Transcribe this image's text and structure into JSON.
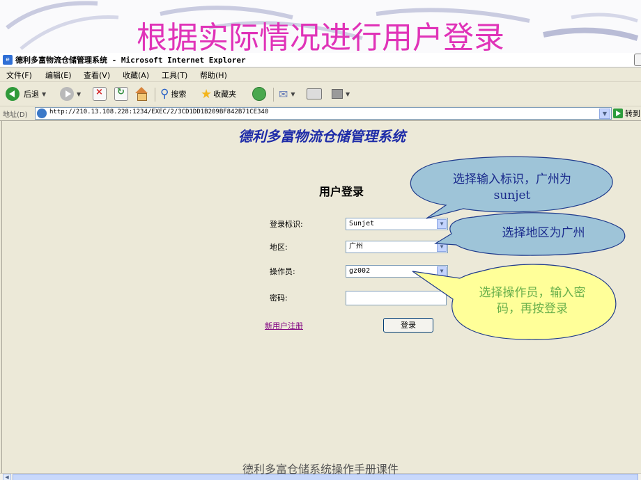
{
  "slide": {
    "title": "根据实际情况进行用户登录",
    "footer": "德利多富仓储系统操作手册课件"
  },
  "window": {
    "title": "德利多富物流仓储管理系统 - Microsoft Internet Explorer"
  },
  "menu": [
    "文件(F)",
    "编辑(E)",
    "查看(V)",
    "收藏(A)",
    "工具(T)",
    "帮助(H)"
  ],
  "toolbar": {
    "back_label": "后退",
    "search_label": "搜索",
    "favorites_label": "收藏夹"
  },
  "address": {
    "label": "地址(D)",
    "url": "http://210.13.108.228:1234/EXEC/2/3CD1DD1B209BF842B71CE340",
    "go_label": "转到"
  },
  "page": {
    "system_title": "德利多富物流仓储管理系统",
    "login_title": "用户登录",
    "login_id_label": "登录标识:",
    "login_id_value": "Sunjet",
    "region_label": "地区:",
    "region_value": "广州",
    "operator_label": "操作员:",
    "operator_value": "gz002",
    "password_label": "密码:",
    "register_link": "新用户注册",
    "login_button": "登录"
  },
  "callouts": {
    "login_id": "选择输入标识，广州为sunjet",
    "region": "选择地区为广州",
    "operator": "选择操作员，输入密码，再按登录"
  },
  "colors": {
    "title_pink": "#e033b8",
    "callout_fill": "#9ec4d8",
    "callout_text_blue": "#1a2a8c",
    "callout_fill_yellow": "#ffff99",
    "callout_text_green": "#6ab04c",
    "system_title_blue": "#1e2ca8"
  }
}
